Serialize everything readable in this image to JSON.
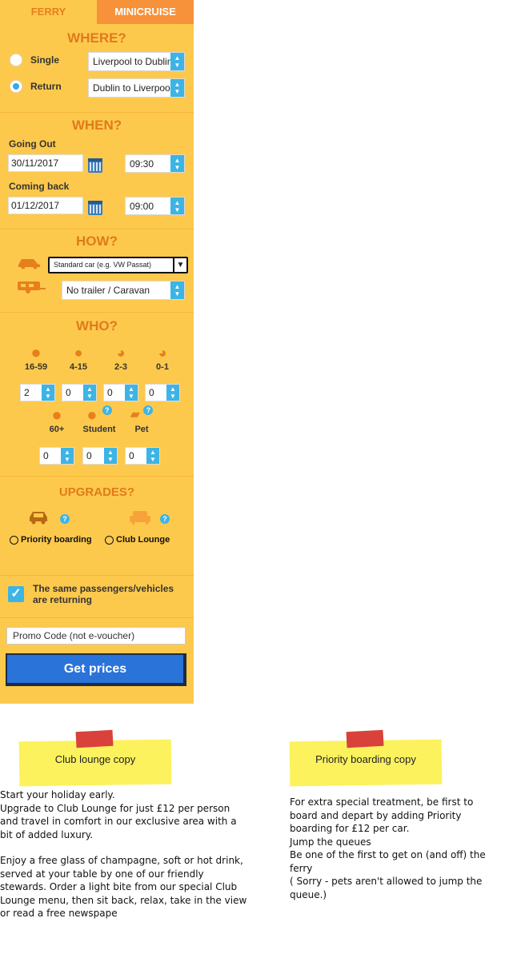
{
  "tabs": {
    "ferry": "FERRY",
    "minicruise": "MINICRUISE"
  },
  "where": {
    "title": "WHERE?",
    "single_label": "Single",
    "return_label": "Return",
    "single_route": "Liverpool to Dublin",
    "return_route": "Dublin to Liverpool",
    "selected": "return"
  },
  "when": {
    "title": "WHEN?",
    "going_out_label": "Going Out",
    "going_out_date": "30/11/2017",
    "going_out_time": "09:30",
    "coming_back_label": "Coming back",
    "coming_back_date": "01/12/2017",
    "coming_back_time": "09:00"
  },
  "how": {
    "title": "HOW?",
    "vehicle": "Standard car (e.g. VW Passat)",
    "trailer": "No trailer / Caravan"
  },
  "who": {
    "title": "WHO?",
    "adults_label": "16-59",
    "adults": "2",
    "children_label": "4-15",
    "children": "0",
    "toddlers_label": "2-3",
    "toddlers": "0",
    "infants_label": "0-1",
    "infants": "0",
    "seniors_label": "60+",
    "seniors": "0",
    "students_label": "Student",
    "students": "0",
    "pets_label": "Pet",
    "pets": "0",
    "help_mark": "?"
  },
  "upgrades": {
    "title": "UPGRADES?",
    "priority_label": "Priority boarding",
    "lounge_label": "Club Lounge",
    "help_mark": "?"
  },
  "same_passengers": {
    "checked": true,
    "label": "The same passengers/vehicles are returning",
    "check_mark": "✓"
  },
  "promo_placeholder": "Promo Code (not e-voucher)",
  "get_prices": "Get prices",
  "notes": {
    "club": {
      "title": "Club lounge copy",
      "p1": "Start your holiday early.",
      "p2": "Upgrade to Club Lounge  for just £12 per person and travel in comfort in our exclusive area with a bit of added luxury.",
      "p3": "Enjoy a free glass of champagne, soft or hot drink, served at your table by one of our friendly stewards. Order a light bite from our special Club Lounge menu, then sit back, relax, take in the view or read a free newspape"
    },
    "priority": {
      "title": "Priority boarding copy",
      "p1": "For extra special treatment, be first to board and depart by adding Priority boarding for £12 per car.",
      "p2": "Jump the queues",
      "p3": "Be one of the first to get on (and off) the ferry",
      "p4": "( Sorry - pets aren't allowed to jump the queue.)"
    }
  },
  "colors": {
    "panel": "#fdc94c",
    "accent": "#e07a1c",
    "tab_active": "#f7913a",
    "control": "#3cb4e6",
    "button": "#2a73d9"
  },
  "icons": [
    "calendar-icon",
    "car-icon",
    "caravan-icon",
    "adult-icon",
    "child-icon",
    "pram-icon",
    "pet-icon",
    "sofa-icon",
    "check-icon"
  ]
}
